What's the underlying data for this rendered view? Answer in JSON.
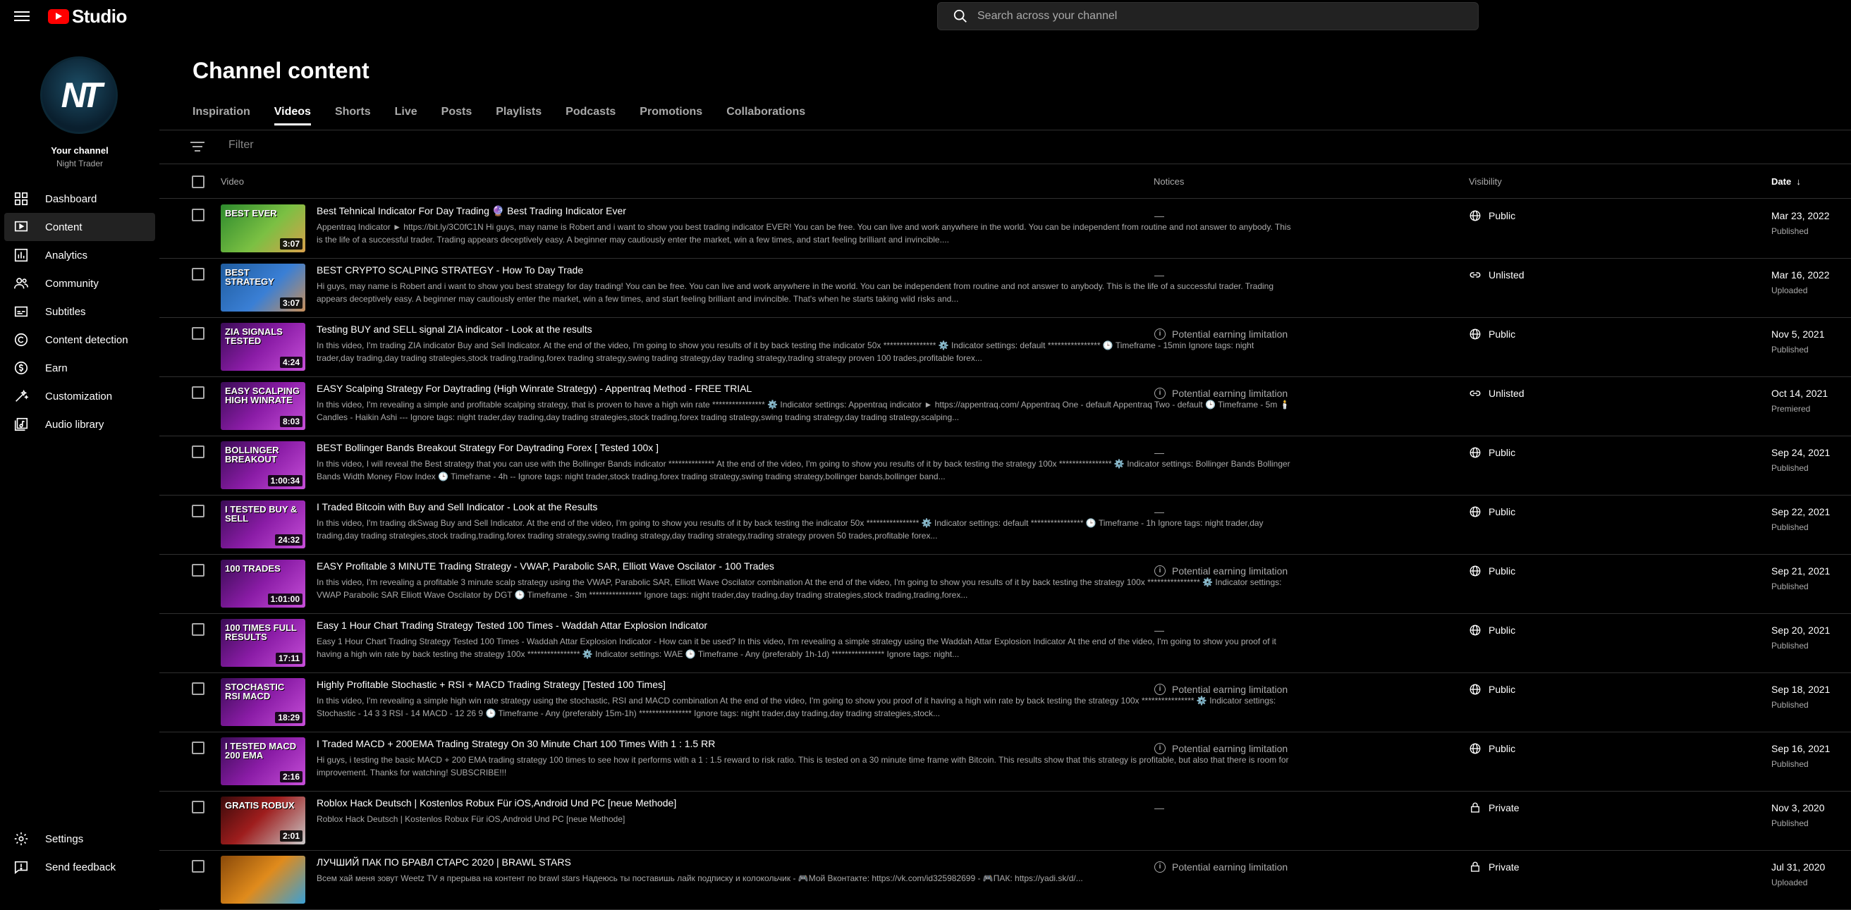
{
  "app": {
    "logo_text": "Studio"
  },
  "search": {
    "placeholder": "Search across your channel"
  },
  "channel": {
    "label": "Your channel",
    "name": "Night Trader",
    "avatar_monogram": "NT"
  },
  "nav": {
    "items": [
      {
        "label": "Dashboard",
        "icon": "dashboard-icon"
      },
      {
        "label": "Content",
        "icon": "content-icon",
        "active": true
      },
      {
        "label": "Analytics",
        "icon": "analytics-icon"
      },
      {
        "label": "Community",
        "icon": "community-icon"
      },
      {
        "label": "Subtitles",
        "icon": "subtitles-icon"
      },
      {
        "label": "Content detection",
        "icon": "copyright-icon"
      },
      {
        "label": "Earn",
        "icon": "earn-icon"
      },
      {
        "label": "Customization",
        "icon": "customization-icon"
      },
      {
        "label": "Audio library",
        "icon": "audio-library-icon"
      }
    ],
    "bottom": [
      {
        "label": "Settings",
        "icon": "gear-icon"
      },
      {
        "label": "Send feedback",
        "icon": "feedback-icon"
      }
    ]
  },
  "page": {
    "title": "Channel content"
  },
  "tabs": [
    "Inspiration",
    "Videos",
    "Shorts",
    "Live",
    "Posts",
    "Playlists",
    "Podcasts",
    "Promotions",
    "Collaborations"
  ],
  "active_tab": "Videos",
  "filter": {
    "placeholder": "Filter"
  },
  "columns": {
    "video": "Video",
    "notices": "Notices",
    "visibility": "Visibility",
    "date": "Date"
  },
  "videos": [
    {
      "title": "Best Tehnical Indicator For Day Trading 🔮 Best Trading Indicator Ever",
      "description": "Appentraq Indicator ► https://bit.ly/3C0fC1N Hi guys, may name is Robert and i want to show you best trading indicator EVER! You can be free. You can live and work anywhere in the world. You can be independent from routine and not answer to anybody. This is the life of a successful trader. Trading appears deceptively easy. A beginner may cautiously enter the market, win a few times, and start feeling brilliant and invincible....",
      "duration": "3:07",
      "thumb_text": "BEST EVER",
      "notice": "—",
      "visibility": "Public",
      "date": "Mar 23, 2022",
      "status": "Published",
      "theme": "t-green"
    },
    {
      "title": "BEST CRYPTO SCALPING STRATEGY - How To Day Trade",
      "description": "Hi guys, may name is Robert and i want to show you best strategy for day trading! You can be free. You can live and work anywhere in the world. You can be independent from routine and not answer to anybody. This is the life of a successful trader. Trading appears deceptively easy. A beginner may cautiously enter the market, win a few times, and start feeling brilliant and invincible. That's when he starts taking wild risks and...",
      "duration": "3:07",
      "thumb_text": "BEST STRATEGY",
      "notice": "—",
      "visibility": "Unlisted",
      "date": "Mar 16, 2022",
      "status": "Uploaded",
      "theme": "t-blue"
    },
    {
      "title": "Testing BUY and SELL signal ZIA indicator - Look at the results",
      "description": "In this video, I'm trading ZIA indicator Buy and Sell Indicator. At the end of the video, I'm going to show you results of it by back testing the indicator 50x **************** ⚙️ Indicator settings: default **************** 🕒 Timeframe - 15min Ignore tags: night trader,day trading,day trading strategies,stock trading,trading,forex trading strategy,swing trading strategy,day trading strategy,trading strategy proven 100 trades,profitable forex...",
      "duration": "4:24",
      "thumb_text": "ZIA SIGNALS TESTED",
      "notice": "Potential earning limitation",
      "visibility": "Public",
      "date": "Nov 5, 2021",
      "status": "Published",
      "theme": "t-purple"
    },
    {
      "title": "EASY Scalping Strategy For Daytrading (High Winrate Strategy) - Appentraq Method - FREE TRIAL",
      "description": "In this video, I'm revealing a simple and profitable scalping strategy, that is proven to have a high win rate **************** ⚙️ Indicator settings: Appentraq indicator ► https://appentraq.com/ Appentraq One - default Appentraq Two - default 🕒 Timeframe - 5m 🕯️ Candles - Haikin Ashi --- Ignore tags: night trader,day trading,day trading strategies,stock trading,forex trading strategy,swing trading strategy,day trading strategy,scalping...",
      "duration": "8:03",
      "thumb_text": "EASY SCALPING HIGH WINRATE",
      "notice": "Potential earning limitation",
      "visibility": "Unlisted",
      "date": "Oct 14, 2021",
      "status": "Premiered",
      "theme": "t-purple"
    },
    {
      "title": "BEST Bollinger Bands Breakout Strategy For Daytrading Forex [ Tested 100x ]",
      "description": "In this video, I will reveal the Best strategy that you can use with the Bollinger Bands indicator ************** At the end of the video, I'm going to show you results of it by back testing the strategy 100x **************** ⚙️ Indicator settings: Bollinger Bands Bollinger Bands Width Money Flow Index 🕒 Timeframe - 4h -- Ignore tags: night trader,stock trading,forex trading strategy,swing trading strategy,bollinger bands,bollinger band...",
      "duration": "1:00:34",
      "thumb_text": "BOLLINGER BREAKOUT",
      "notice": "—",
      "visibility": "Public",
      "date": "Sep 24, 2021",
      "status": "Published",
      "theme": "t-purple"
    },
    {
      "title": "I Traded Bitcoin with Buy and Sell Indicator - Look at the Results",
      "description": "In this video, I'm trading dkSwag Buy and Sell Indicator. At the end of the video, I'm going to show you results of it by back testing the indicator 50x **************** ⚙️ Indicator settings: default **************** 🕒 Timeframe - 1h Ignore tags: night trader,day trading,day trading strategies,stock trading,trading,forex trading strategy,swing trading strategy,day trading strategy,trading strategy proven 50 trades,profitable forex...",
      "duration": "24:32",
      "thumb_text": "I TESTED BUY & SELL",
      "notice": "—",
      "visibility": "Public",
      "date": "Sep 22, 2021",
      "status": "Published",
      "theme": "t-purple"
    },
    {
      "title": "EASY Profitable 3 MINUTE Trading Strategy - VWAP, Parabolic SAR, Elliott Wave Oscilator - 100 Trades",
      "description": "In this video, I'm revealing a profitable 3 minute scalp strategy using the VWAP, Parabolic SAR, Elliott Wave Oscilator combination At the end of the video, I'm going to show you results of it by back testing the strategy 100x **************** ⚙️ Indicator settings: VWAP Parabolic SAR Elliott Wave Oscilator by DGT 🕒 Timeframe - 3m **************** Ignore tags: night trader,day trading,day trading strategies,stock trading,trading,forex...",
      "duration": "1:01:00",
      "thumb_text": "100 TRADES",
      "notice": "Potential earning limitation",
      "visibility": "Public",
      "date": "Sep 21, 2021",
      "status": "Published",
      "theme": "t-purple"
    },
    {
      "title": "Easy 1 Hour Chart Trading Strategy Tested 100 Times - Waddah Attar Explosion Indicator",
      "description": "Easy 1 Hour Chart Trading Strategy Tested 100 Times - Waddah Attar Explosion Indicator - How can it be used? In this video, I'm revealing a simple strategy using the Waddah Attar Explosion Indicator At the end of the video, I'm going to show you proof of it having a high win rate by back testing the strategy 100x **************** ⚙️ Indicator settings: WAE 🕒 Timeframe - Any (preferably 1h-1d) **************** Ignore tags: night...",
      "duration": "17:11",
      "thumb_text": "100 TIMES FULL RESULTS",
      "notice": "—",
      "visibility": "Public",
      "date": "Sep 20, 2021",
      "status": "Published",
      "theme": "t-purple"
    },
    {
      "title": "Highly Profitable Stochastic + RSI + MACD Trading Strategy [Tested 100 Times]",
      "description": "In this video, I'm revealing a simple high win rate strategy using the stochastic, RSI and MACD combination At the end of the video, I'm going to show you proof of it having a high win rate by back testing the strategy 100x **************** ⚙️ Indicator settings: Stochastic - 14 3 3 RSI - 14 MACD - 12 26 9 🕒 Timeframe - Any (preferably 15m-1h) **************** Ignore tags: night trader,day trading,day trading strategies,stock...",
      "duration": "18:29",
      "thumb_text": "STOCHASTIC RSI MACD",
      "notice": "Potential earning limitation",
      "visibility": "Public",
      "date": "Sep 18, 2021",
      "status": "Published",
      "theme": "t-purple"
    },
    {
      "title": "I Traded MACD + 200EMA Trading Strategy On 30 Minute Chart 100 Times With 1 : 1.5 RR",
      "description": "Hi guys, i testing the basic MACD + 200 EMA trading strategy 100 times to see how it performs with a 1 : 1.5 reward to risk ratio. This is tested on a 30 minute time frame with Bitcoin. This results show that this strategy is profitable, but also that there is room for improvement. Thanks for watching! SUBSCRIBE!!!",
      "duration": "2:16",
      "thumb_text": "I TESTED MACD 200 EMA",
      "notice": "Potential earning limitation",
      "visibility": "Public",
      "date": "Sep 16, 2021",
      "status": "Published",
      "theme": "t-purple"
    },
    {
      "title": "Roblox Hack Deutsch | Kostenlos Robux Für iOS,Android Und PC [neue Methode]",
      "description": "Roblox Hack Deutsch | Kostenlos Robux Für iOS,Android Und PC [neue Methode]",
      "duration": "2:01",
      "thumb_text": "GRATIS ROBUX",
      "notice": "—",
      "visibility": "Private",
      "date": "Nov 3, 2020",
      "status": "Published",
      "theme": "t-red"
    },
    {
      "title": "ЛУЧШИЙ ПАК ПО БРАВЛ СТАРС 2020 | BRAWL STARS",
      "description": "Всем хай меня зовут Weetz TV я прерыва на контент по brawl stars Надеюсь ты поставишь лайк подписку и колокольчик - 🎮Мой Вконтакте: https://vk.com/id325982699 - 🎮ПАК: https://yadi.sk/d/...",
      "duration": "",
      "thumb_text": "",
      "notice": "Potential earning limitation",
      "visibility": "Private",
      "date": "Jul 31, 2020",
      "status": "Uploaded",
      "theme": "t-orange"
    }
  ]
}
